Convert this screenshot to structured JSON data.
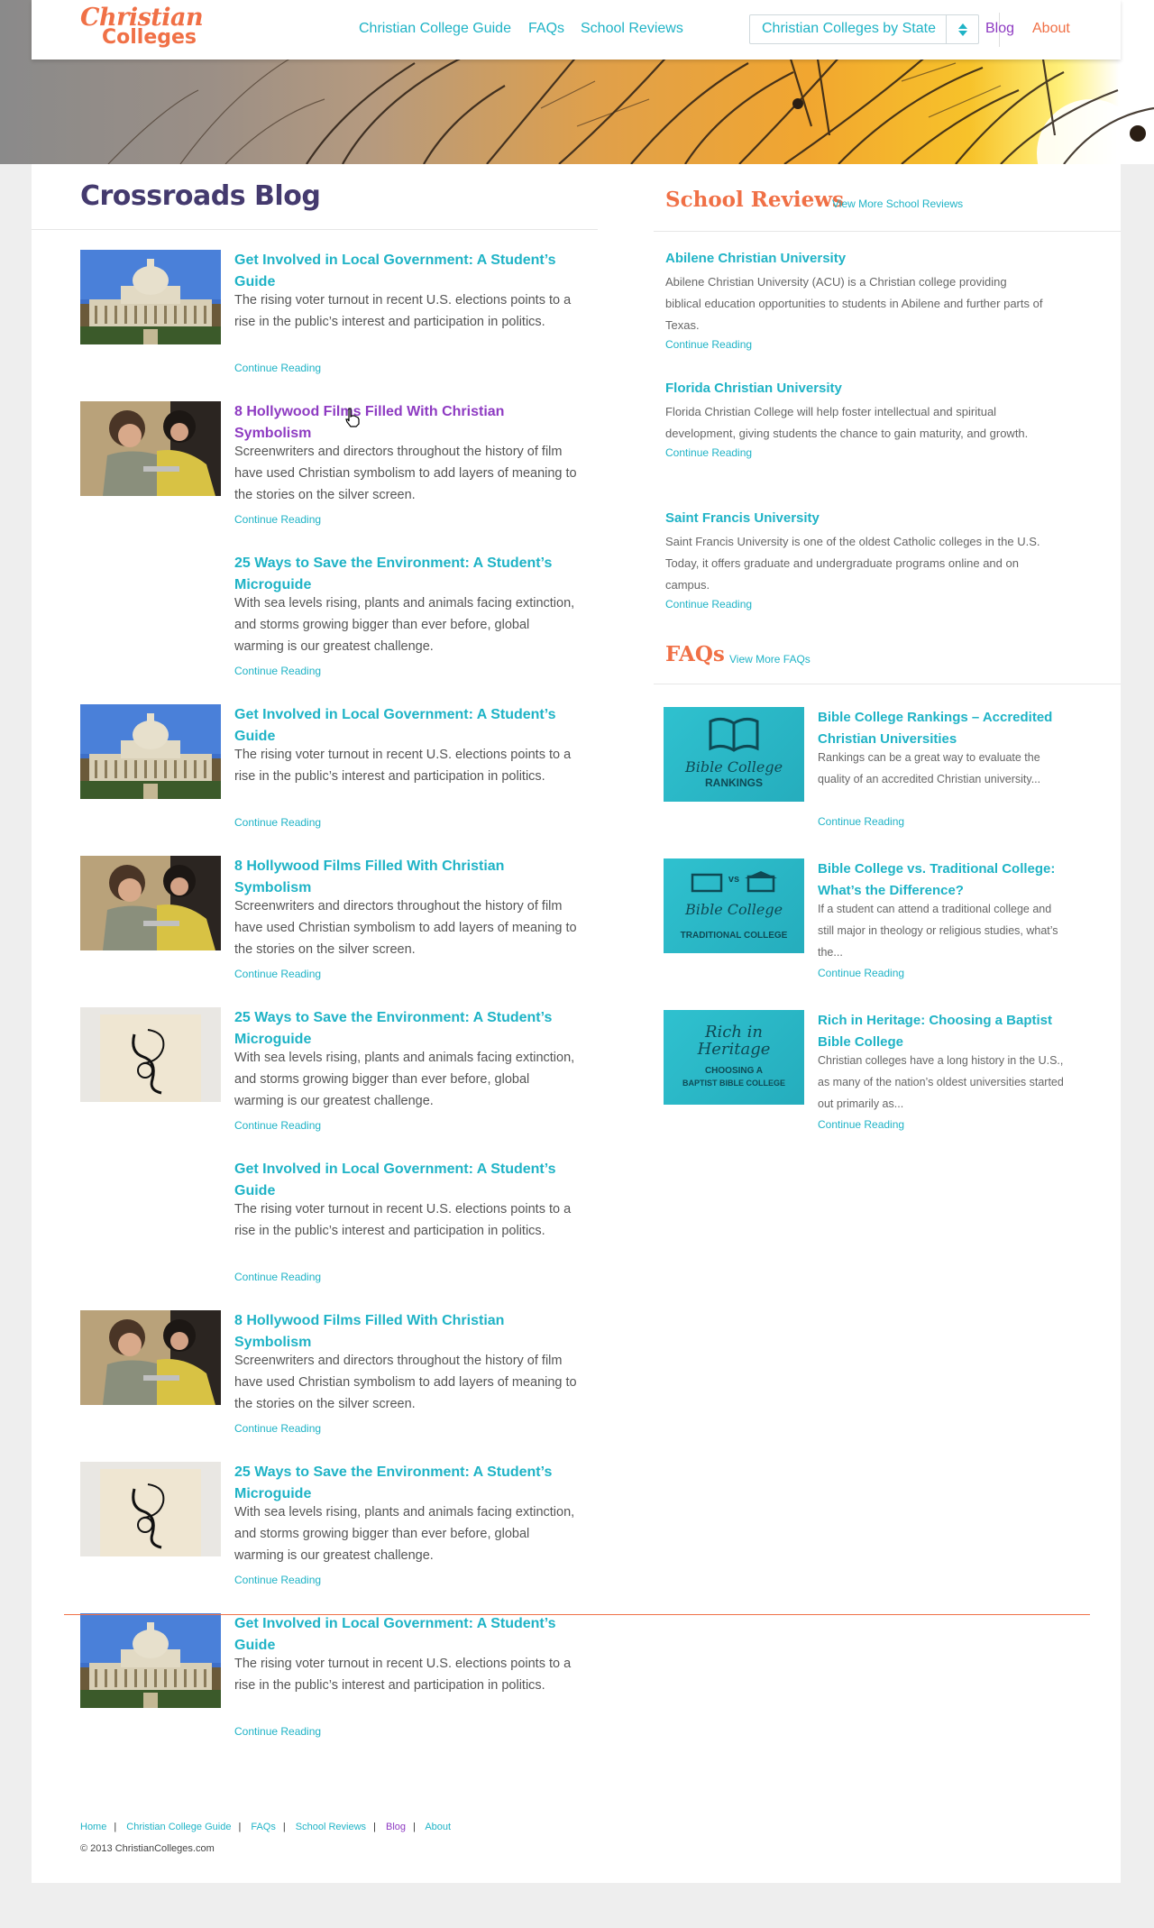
{
  "site": {
    "logo_line1": "Christian",
    "logo_line2": "Colleges"
  },
  "nav": {
    "guide": "Christian College Guide",
    "faqs": "FAQs",
    "reviews": "School Reviews",
    "state_select": "Christian Colleges by State",
    "blog": "Blog",
    "about": "About"
  },
  "colors": {
    "accent_teal": "#1fb3c6",
    "accent_orange": "#f07046",
    "visited_purple": "#8e3bc2",
    "title_indigo": "#443a6e"
  },
  "blog": {
    "title": "Crossroads Blog",
    "posts": [
      {
        "image": "capitol",
        "title": "Get Involved in Local Government: A Student’s Guide",
        "excerpt": "The rising voter turnout in recent U.S. elections points to a rise in the public’s interest and participation in politics.",
        "more": "Continue Reading"
      },
      {
        "image": "film",
        "title": "8 Hollywood Films Filled With Christian Symbolism",
        "excerpt": "Screenwriters and directors throughout the history of film have used Christian symbolism to add layers of meaning to the stories on the silver screen.",
        "more": "Continue Reading"
      },
      {
        "image": "none",
        "title": "25 Ways to Save the Environment: A Student’s Microguide",
        "excerpt": "With sea levels rising, plants and animals facing extinction, and storms growing bigger than ever before, global warming is our greatest challenge.",
        "more": "Continue Reading"
      },
      {
        "image": "capitol",
        "title": "Get Involved in Local Government: A Student’s Guide",
        "excerpt": "The rising voter turnout in recent U.S. elections points to a rise in the public’s interest and participation in politics.",
        "more": "Continue Reading"
      },
      {
        "image": "film",
        "title": "8 Hollywood Films Filled With Christian Symbolism",
        "excerpt": "Screenwriters and directors throughout the history of film have used Christian symbolism to add layers of meaning to the stories on the silver screen.",
        "more": "Continue Reading"
      },
      {
        "image": "tote",
        "title": "25 Ways to Save the Environment: A Student’s Microguide",
        "excerpt": "With sea levels rising, plants and animals facing extinction, and storms growing bigger than ever before, global warming is our greatest challenge.",
        "more": "Continue Reading"
      },
      {
        "image": "none",
        "title": "Get Involved in Local Government: A Student’s Guide",
        "excerpt": "The rising voter turnout in recent U.S. elections points to a rise in the public’s interest and participation in politics.",
        "more": "Continue Reading"
      },
      {
        "image": "film",
        "title": "8 Hollywood Films Filled With Christian Symbolism",
        "excerpt": "Screenwriters and directors throughout the history of film have used Christian symbolism to add layers of meaning to the stories on the silver screen.",
        "more": "Continue Reading"
      },
      {
        "image": "tote",
        "title": "25 Ways to Save the Environment: A Student’s Microguide",
        "excerpt": "With sea levels rising, plants and animals facing extinction, and storms growing bigger than ever before, global warming is our greatest challenge.",
        "more": "Continue Reading"
      },
      {
        "image": "capitol",
        "title": "Get Involved in Local Government: A Student’s Guide",
        "excerpt": "The rising voter turnout in recent U.S. elections points to a rise in the public’s interest and participation in politics.",
        "more": "Continue Reading"
      }
    ]
  },
  "reviews": {
    "heading": "School Reviews",
    "more": "View More School Reviews",
    "items": [
      {
        "title": "Abilene Christian University",
        "text": "Abilene Christian University (ACU) is a Christian college providing biblical education opportunities to students in Abilene and further parts of Texas.",
        "more": "Continue Reading"
      },
      {
        "title": "Florida Christian University",
        "text": "Florida Christian College will help foster intellectual and spiritual development, giving students the chance to gain maturity, and growth.",
        "more": "Continue Reading"
      },
      {
        "title": "Saint Francis University",
        "text": "Saint Francis University is one of the oldest Catholic colleges in the U.S. Today, it offers graduate and undergraduate programs online and on campus.",
        "more": "Continue Reading"
      }
    ]
  },
  "faqs": {
    "heading": "FAQs",
    "more": "View More FAQs",
    "items": [
      {
        "title": "Bible College Rankings – Accredited Christian Universities",
        "text": "Rankings can be a great way to evaluate the quality of an accredited Christian university...",
        "more": "Continue Reading",
        "img_l1": "Bible College",
        "img_l2": "RANKINGS"
      },
      {
        "title": "Bible College vs. Traditional College: What’s the Difference?",
        "text": "If a student can attend a traditional college and still major in theology or religious studies, what’s the...",
        "more": "Continue Reading",
        "img_l1": "Bible College",
        "img_vs": "vs",
        "img_l2": "TRADITIONAL COLLEGE"
      },
      {
        "title": "Rich in Heritage: Choosing a Baptist Bible College",
        "text": "Christian colleges have a long history in the U.S., as many of the nation’s oldest universities started out primarily as...",
        "more": "Continue Reading",
        "img_l1": "Rich in",
        "img_l1b": "Heritage",
        "img_l2": "CHOOSING A",
        "img_l3": "BAPTIST BIBLE COLLEGE"
      }
    ]
  },
  "footer": {
    "links": [
      "Home",
      "Christian College Guide",
      "FAQs",
      "School Reviews",
      "Blog",
      "About"
    ],
    "copyright": "© 2013 ChristianColleges.com"
  }
}
